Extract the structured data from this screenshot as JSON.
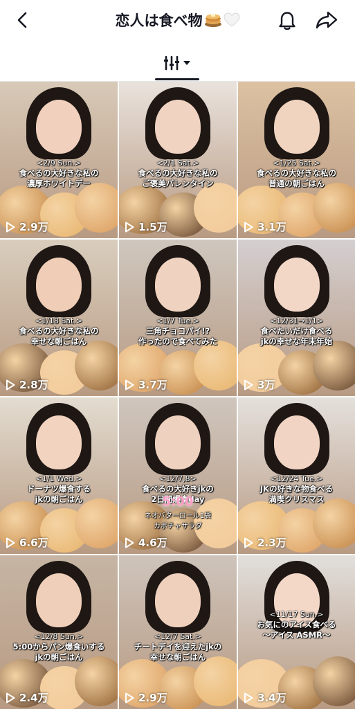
{
  "header": {
    "title": "恋人は食べ物",
    "back_icon": "chevron-left-icon",
    "bell_icon": "bell-icon",
    "share_icon": "share-icon",
    "title_emojis": [
      "pancake-icon",
      "white-heart-icon"
    ]
  },
  "tabs": {
    "filter_icon": "sort-filter-icon",
    "dropdown_icon": "caret-down-icon"
  },
  "videos": [
    {
      "date": "<2/9 Sun.>",
      "caption": "食べるの大好きな私の\n濃厚ホワイトデー",
      "views": "2.9万",
      "bg": "#d8c9b8",
      "face": "#f1d1bd"
    },
    {
      "date": "<2/1 Sat.>",
      "caption": "食べるの大好きな私の\nご褒美バレンタイン",
      "views": "1.5万",
      "bg": "#e9e2dc",
      "face": "#f1d3c1"
    },
    {
      "date": "<1/25 Sat.>",
      "caption": "食べるの大好きな私の\n普通の朝ごはん",
      "views": "3.1万",
      "bg": "#dcc1a2",
      "face": "#f0d4bf"
    },
    {
      "date": "<1/18 Sat.>",
      "caption": "食べるの大好きな私の\n幸せな朝ごはん",
      "views": "2.8万",
      "bg": "#d9cdbd",
      "face": "#efcdb6"
    },
    {
      "date": "<1/7 Tue.>",
      "caption": "三角チョコパイ!?\n作ったので食べてみた",
      "views": "3.7万",
      "bg": "#cfc7be",
      "face": "#efd2bf"
    },
    {
      "date": "<12/31→1/1>",
      "caption": "食べたいだけ食べる\njkの幸せな年末年始",
      "views": "3万",
      "bg": "#d4cfd0",
      "face": "#f2d6c6"
    },
    {
      "date": "<1/1 Wed.>",
      "caption": "ドーナツ爆食する\njkの朝ごはん",
      "views": "6.6万",
      "bg": "#e3dcd0",
      "face": "#f2d3bf"
    },
    {
      "date": "<12/7,8>",
      "caption": "食べるの大好きjkの\n2日間爆食day",
      "views": "4.6万",
      "bg": "#cfc6be",
      "face": "#efd1bf",
      "timer": "5:00",
      "extra": "ネオバターロール1袋\nカボチャサラダ"
    },
    {
      "date": "<12/24 Tue.>",
      "caption": "JKの好きな物食べる\n満喫クリスマス",
      "views": "2.3万",
      "bg": "#e4e0dc",
      "face": "#f1d4c3"
    },
    {
      "date": "<12/8 Sun.>",
      "caption": "5:00からパン爆食いする\njkの朝ごはん",
      "views": "2.4万",
      "bg": "#c6b5a4",
      "face": "#efcfb9"
    },
    {
      "date": "<12/7 Sat.>",
      "caption": "チートデイを迎えたjkの\n幸せな朝ごはん",
      "views": "2.9万",
      "bg": "#cec4bb",
      "face": "#efd0bd"
    },
    {
      "date": "<11/17 Sun.>",
      "caption": "お気にのアイス食べる\n〜アイス ASMR〜",
      "views": "3.4万",
      "bg": "#e2dfdc",
      "face": "#f3d8c8"
    }
  ]
}
